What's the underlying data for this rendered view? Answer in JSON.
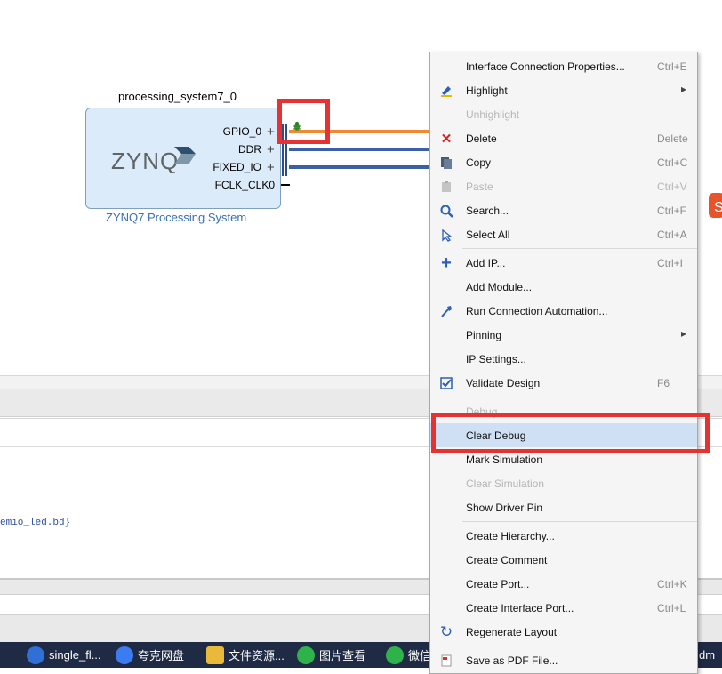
{
  "canvas": {
    "block_name": "processing_system7_0",
    "logo_text": "ZYNQ",
    "block_subtitle": "ZYNQ7 Processing System",
    "ports": [
      "GPIO_0",
      "DDR",
      "FIXED_IO",
      "FCLK_CLK0"
    ]
  },
  "log": {
    "text": "emio_led.bd}"
  },
  "menu": {
    "items": [
      {
        "label": "Interface Connection Properties...",
        "shortcut": "Ctrl+E",
        "icon": "none",
        "disabled": false
      },
      {
        "label": "Highlight",
        "shortcut": "",
        "icon": "highlight-icon",
        "submenu": true,
        "disabled": false
      },
      {
        "label": "Unhighlight",
        "shortcut": "",
        "icon": "none",
        "disabled": true
      },
      {
        "label": "Delete",
        "shortcut": "Delete",
        "icon": "delete-icon",
        "disabled": false
      },
      {
        "label": "Copy",
        "shortcut": "Ctrl+C",
        "icon": "copy-icon",
        "disabled": false
      },
      {
        "label": "Paste",
        "shortcut": "Ctrl+V",
        "icon": "paste-icon",
        "disabled": true
      },
      {
        "label": "Search...",
        "shortcut": "Ctrl+F",
        "icon": "search-icon",
        "disabled": false
      },
      {
        "label": "Select All",
        "shortcut": "Ctrl+A",
        "icon": "select-all-icon",
        "disabled": false
      },
      {
        "label": "Add IP...",
        "shortcut": "Ctrl+I",
        "icon": "plus-icon",
        "disabled": false
      },
      {
        "label": "Add Module...",
        "shortcut": "",
        "icon": "none",
        "disabled": false
      },
      {
        "label": "Run Connection Automation...",
        "shortcut": "",
        "icon": "automation-icon",
        "disabled": false
      },
      {
        "label": "Pinning",
        "shortcut": "",
        "icon": "none",
        "submenu": true,
        "disabled": false
      },
      {
        "label": "IP Settings...",
        "shortcut": "",
        "icon": "none",
        "disabled": false
      },
      {
        "label": "Validate Design",
        "shortcut": "F6",
        "icon": "validate-icon",
        "disabled": false
      },
      {
        "label": "Debug",
        "shortcut": "",
        "icon": "none",
        "disabled": true
      },
      {
        "label": "Clear Debug",
        "shortcut": "",
        "icon": "none",
        "disabled": false,
        "selected": true
      },
      {
        "label": "Mark Simulation",
        "shortcut": "",
        "icon": "none",
        "disabled": false
      },
      {
        "label": "Clear Simulation",
        "shortcut": "",
        "icon": "none",
        "disabled": true
      },
      {
        "label": "Show Driver Pin",
        "shortcut": "",
        "icon": "none",
        "disabled": false
      },
      {
        "label": "Create Hierarchy...",
        "shortcut": "",
        "icon": "none",
        "disabled": false
      },
      {
        "label": "Create Comment",
        "shortcut": "",
        "icon": "none",
        "disabled": false
      },
      {
        "label": "Create Port...",
        "shortcut": "Ctrl+K",
        "icon": "none",
        "disabled": false
      },
      {
        "label": "Create Interface Port...",
        "shortcut": "Ctrl+L",
        "icon": "none",
        "disabled": false
      },
      {
        "label": "Regenerate Layout",
        "shortcut": "",
        "icon": "refresh-icon",
        "disabled": false
      },
      {
        "label": "Save as PDF File...",
        "shortcut": "",
        "icon": "pdf-icon",
        "disabled": false
      }
    ]
  },
  "taskbar": {
    "items": [
      {
        "label": "single_fl...",
        "icon": "app-icon",
        "color": "#2f6fd6"
      },
      {
        "label": "夸克网盘",
        "icon": "cloud-icon",
        "color": "#3b7df0"
      },
      {
        "label": "文件资源...",
        "icon": "folder-icon",
        "color": "#e8b93a"
      },
      {
        "label": "图片查看",
        "icon": "wechat-icon",
        "color": "#2db34a"
      },
      {
        "label": "微信",
        "icon": "wechat-icon",
        "color": "#2db34a"
      },
      {
        "label": "dm",
        "icon": "app-icon",
        "color": "#555555"
      }
    ]
  },
  "colors": {
    "gpio_wire": "#f08a32",
    "bus_wire": "#3d5fa8",
    "highlight_box": "#e63232",
    "menu_selected": "#cfe0f5"
  }
}
